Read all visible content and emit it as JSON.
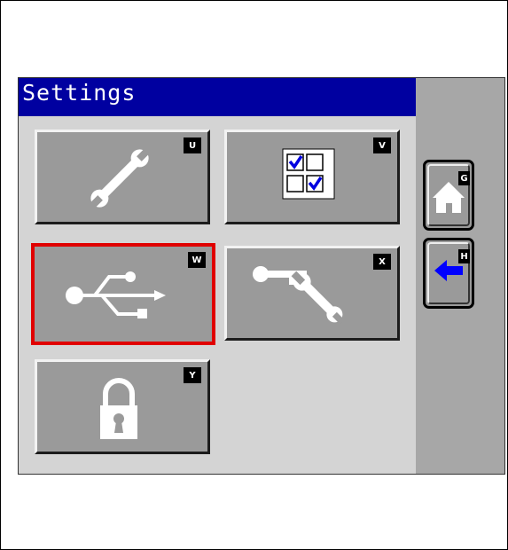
{
  "title": "Settings",
  "tiles": [
    {
      "key": "U",
      "icon": "wrench-icon"
    },
    {
      "key": "V",
      "icon": "checkbox-grid-icon"
    },
    {
      "key": "W",
      "icon": "usb-icon",
      "selected": true
    },
    {
      "key": "X",
      "icon": "key-wrench-icon"
    },
    {
      "key": "Y",
      "icon": "padlock-icon"
    }
  ],
  "side_buttons": [
    {
      "key": "G",
      "icon": "home-icon"
    },
    {
      "key": "H",
      "icon": "back-arrow-icon"
    }
  ],
  "colors": {
    "titlebar": "#0000a0",
    "selected_border": "#e00000",
    "back_arrow": "#0000ff",
    "tile": "#9a9a9a",
    "panel": "#a7a7a7"
  }
}
